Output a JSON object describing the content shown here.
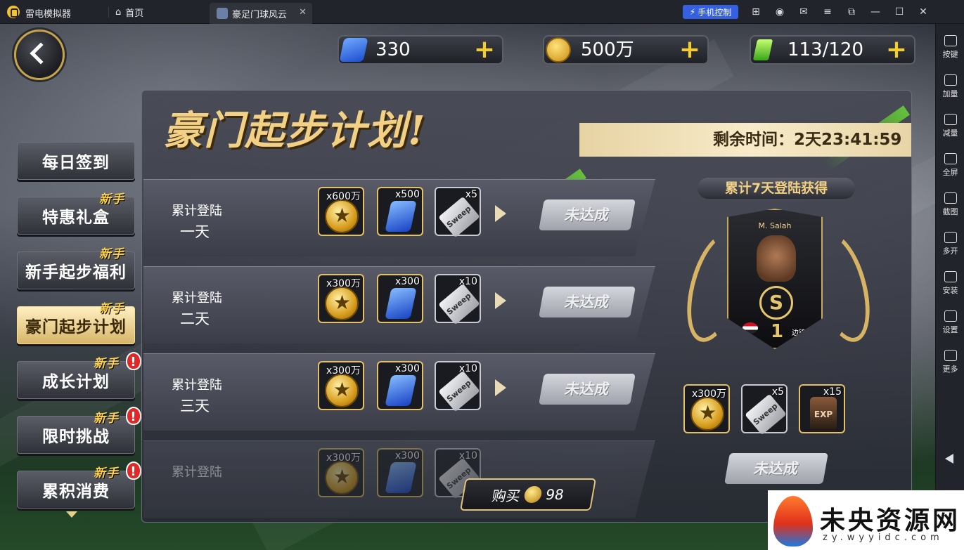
{
  "titlebar": {
    "app_name": "雷电模拟器",
    "home_tab": "首页",
    "game_tab": "豪足门球风云",
    "phone_control": "手机控制"
  },
  "sidebar": {
    "items": [
      {
        "label": "按键",
        "icon": "keyboard-icon"
      },
      {
        "label": "加量",
        "icon": "volume-up-icon"
      },
      {
        "label": "减量",
        "icon": "volume-down-icon"
      },
      {
        "label": "全屏",
        "icon": "fullscreen-icon"
      },
      {
        "label": "截图",
        "icon": "scissors-icon"
      },
      {
        "label": "多开",
        "icon": "multi-instance-icon"
      },
      {
        "label": "安装",
        "icon": "apk-install-icon"
      },
      {
        "label": "设置",
        "icon": "gear-icon"
      },
      {
        "label": "更多",
        "icon": "more-icon"
      }
    ]
  },
  "resources": {
    "gems": "330",
    "coins": "500万",
    "energy": "113/120",
    "plus": "+"
  },
  "menu": {
    "items": [
      {
        "label": "每日签到",
        "new": "",
        "alert": ""
      },
      {
        "label": "特惠礼盒",
        "new": "新手",
        "alert": ""
      },
      {
        "label": "新手起步福利",
        "new": "新手",
        "alert": ""
      },
      {
        "label": "豪门起步计划",
        "new": "新手",
        "alert": ""
      },
      {
        "label": "成长计划",
        "new": "新手",
        "alert": "!"
      },
      {
        "label": "限时挑战",
        "new": "新手",
        "alert": "!"
      },
      {
        "label": "累积消费",
        "new": "新手",
        "alert": "!"
      }
    ]
  },
  "panel": {
    "title": "豪门起步计划!",
    "timer": "剩余时间：2天23:41:59",
    "rows": [
      {
        "line1": "累计登陆",
        "line2": "一天",
        "coins": "x600万",
        "gems": "x500",
        "sweep": "x5",
        "status": "未达成"
      },
      {
        "line1": "累计登陆",
        "line2": "二天",
        "coins": "x300万",
        "gems": "x300",
        "sweep": "x10",
        "status": "未达成"
      },
      {
        "line1": "累计登陆",
        "line2": "三天",
        "coins": "x300万",
        "gems": "x300",
        "sweep": "x10",
        "status": "未达成"
      },
      {
        "line1": "累计登陆",
        "line2": "",
        "coins": "x300万",
        "gems": "x300",
        "sweep": "x10",
        "status": ""
      }
    ],
    "sweep_text": "Sweep",
    "buy_label": "购买",
    "buy_price": "98"
  },
  "reward": {
    "heading": "累计7天登陆获得",
    "player_name": "M. Salah",
    "card_badge": "S",
    "card_rank": "1",
    "card_position": "边锋",
    "items": [
      {
        "qty": "x300万",
        "type": "coin"
      },
      {
        "qty": "x5",
        "type": "sweep"
      },
      {
        "qty": "x15",
        "type": "exp"
      }
    ],
    "exp_text": "EXP",
    "status": "未达成"
  },
  "watermark": {
    "text": "未央资源网",
    "sub": "zy.wyyidc.com"
  }
}
